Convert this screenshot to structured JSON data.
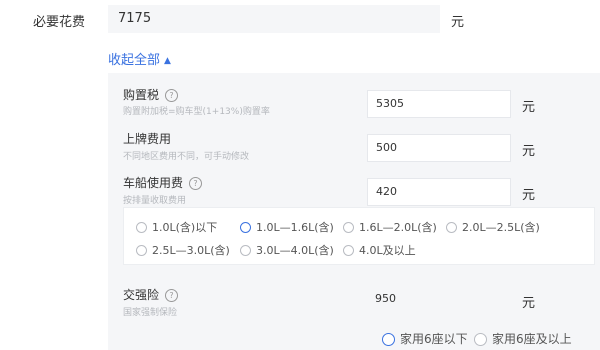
{
  "required": {
    "label": "必要花费",
    "value": "7175",
    "unit": "元"
  },
  "collapse_label": "收起全部",
  "items": [
    {
      "title": "购置税",
      "hint": "购置附加税=购车型(1+13%)购置率",
      "value": "5305",
      "unit": "元"
    },
    {
      "title": "上牌费用",
      "hint": "不同地区费用不同，可手动修改",
      "value": "500",
      "unit": "元"
    },
    {
      "title": "车船使用费",
      "hint": "按排量收取费用",
      "value": "420",
      "unit": "元"
    }
  ],
  "displacement_options": [
    "1.0L(含)以下",
    "1.0L—1.6L(含)",
    "1.6L—2.0L(含)",
    "2.0L—2.5L(含)",
    "2.5L—3.0L(含)",
    "3.0L—4.0L(含)",
    "4.0L及以上"
  ],
  "selected_displacement": "1.0L—1.6L(含)",
  "insurance": {
    "title": "交强险",
    "hint": "国家强制保险",
    "value": "950",
    "unit": "元"
  },
  "seat_options": [
    "家用6座以下",
    "家用6座及以上"
  ],
  "help_glyph": "?",
  "collapse_glyph": "▲",
  "colors": {
    "accent": "#3a72e0",
    "panel_bg": "#f5f6f8",
    "hint": "#b5b8bd"
  }
}
